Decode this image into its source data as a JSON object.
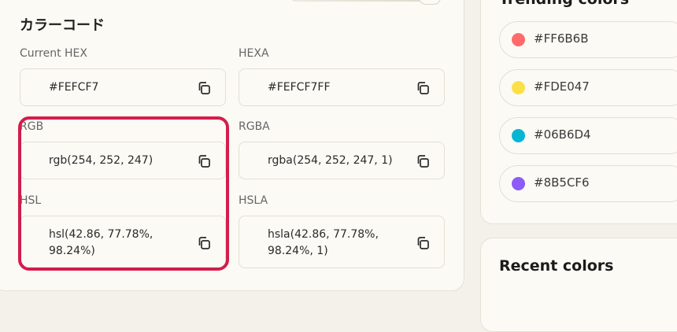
{
  "section_title": "カラーコード",
  "fields": {
    "current_hex": {
      "label": "Current HEX",
      "value": "#FEFCF7"
    },
    "hexa": {
      "label": "HEXA",
      "value": "#FEFCF7FF"
    },
    "rgb": {
      "label": "RGB",
      "value": "rgb(254, 252, 247)"
    },
    "rgba": {
      "label": "RGBA",
      "value": "rgba(254, 252, 247, 1)"
    },
    "hsl": {
      "label": "HSL",
      "value_line1": "hsl(42.86, 77.78%,",
      "value_line2": "98.24%)"
    },
    "hsla": {
      "label": "HSLA",
      "value_line1": "hsla(42.86, 77.78%,",
      "value_line2": "98.24%, 1)"
    }
  },
  "trending": {
    "title": "Trending colors",
    "items": [
      {
        "hex": "#FF6B6B",
        "color": "#FF6B6B"
      },
      {
        "hex": "#FDE047",
        "color": "#FDE047"
      },
      {
        "hex": "#06B6D4",
        "color": "#06B6D4"
      },
      {
        "hex": "#8B5CF6",
        "color": "#8B5CF6"
      }
    ]
  },
  "recent": {
    "title": "Recent colors"
  },
  "colors": {
    "highlight": "#D31D4B",
    "panel_bg": "#FBFAF5",
    "page_bg": "#F3F1EA"
  },
  "icons": {
    "copy": "copy-icon"
  }
}
